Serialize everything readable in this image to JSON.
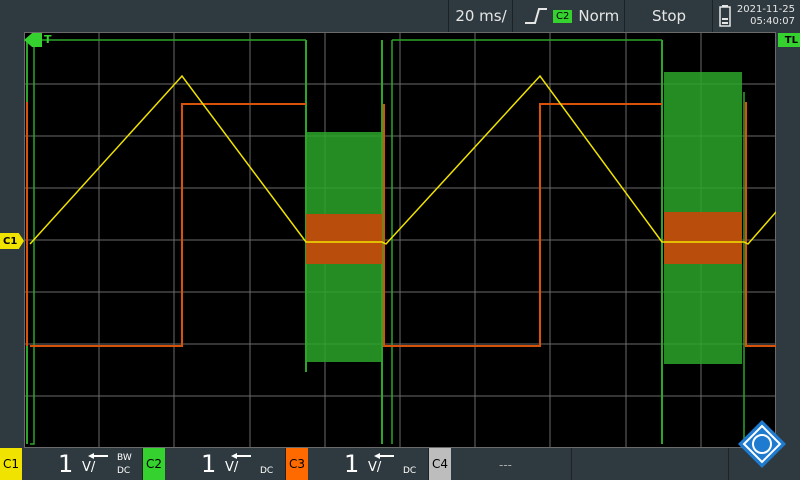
{
  "topbar": {
    "timebase": "20 ms/",
    "trigger_source": "C2",
    "trigger_mode": "Norm",
    "run_state": "Stop",
    "date": "2021-11-25",
    "time": "05:40:07"
  },
  "markers": {
    "trigger_label": "T",
    "trigger_level_label": "TL",
    "channel1_label": "C1"
  },
  "channels": [
    {
      "tag": "C1",
      "value": "1",
      "unit": "V/",
      "bw": "BW",
      "coupling": "DC",
      "color": "#f1e300"
    },
    {
      "tag": "C2",
      "value": "1",
      "unit": "V/",
      "bw": "",
      "coupling": "DC",
      "color": "#35d22f"
    },
    {
      "tag": "C3",
      "value": "1",
      "unit": "V/",
      "bw": "",
      "coupling": "DC",
      "color": "#ff6a00"
    },
    {
      "tag": "C4",
      "value": "",
      "unit": "",
      "bw": "",
      "coupling": "",
      "placeholder": "---",
      "color": "#bdbdbd"
    }
  ],
  "colors": {
    "grid": "#6a6a6a",
    "trace_yellow": "#f1e300",
    "trace_green": "#2ca52a",
    "trace_orange": "#d8520a"
  }
}
